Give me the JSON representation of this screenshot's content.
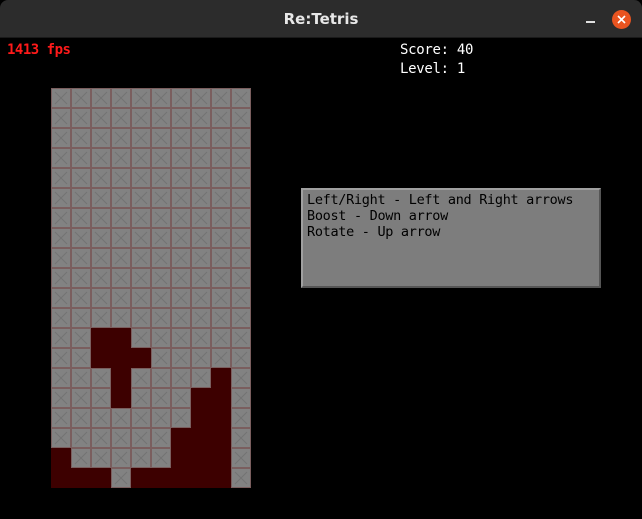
{
  "window": {
    "title": "Re:Tetris"
  },
  "hud": {
    "fps": "1413 fps",
    "score": "Score: 40",
    "level": "Level: 1"
  },
  "help": {
    "lines": [
      "Left/Right - Left and Right arrows",
      "Boost - Down arrow",
      "Rotate - Up arrow"
    ]
  },
  "board": {
    "cols": 10,
    "rows": 20,
    "filled_color": "#3d0000",
    "grid": [
      "..........",
      "..........",
      "..........",
      "..........",
      "..........",
      "..........",
      "..........",
      "..........",
      "..........",
      "..........",
      "..........",
      "..........",
      "..##......",
      "..###.....",
      "...#....#.",
      "...#...##.",
      ".......##.",
      "......###.",
      "#.....###.",
      "###.#####."
    ]
  },
  "colors": {
    "close_button": "#e95420",
    "fps_text": "#ff1a1a"
  }
}
